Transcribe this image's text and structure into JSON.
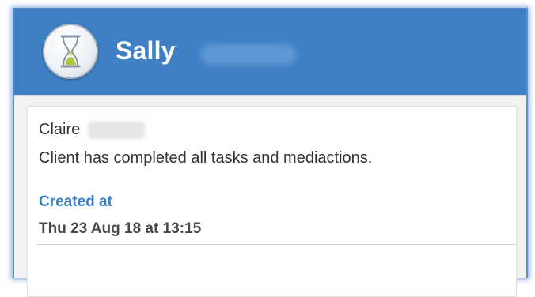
{
  "header": {
    "title": "Sally",
    "icon": "hourglass-icon",
    "accent_color": "#3f80c5"
  },
  "notification": {
    "sender": "Claire",
    "message": "Client has completed all tasks and mediactions.",
    "created_label": "Created at",
    "created_value": "Thu 23 Aug 18 at 13:15",
    "label_color": "#3a7fc1"
  }
}
